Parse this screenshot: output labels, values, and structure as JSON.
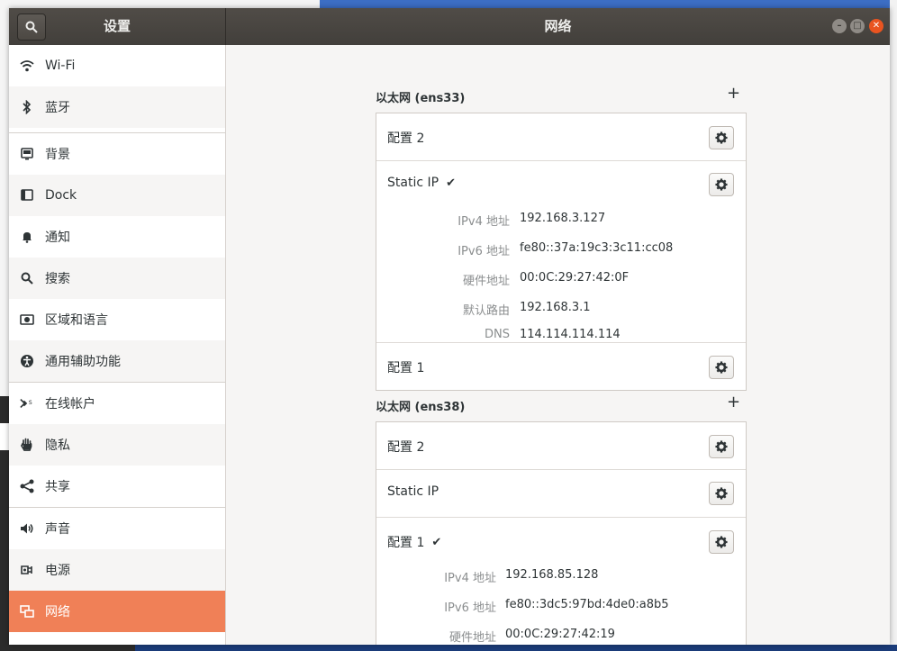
{
  "window": {
    "left_title": "设置",
    "main_title": "网络"
  },
  "sidebar": {
    "items": [
      {
        "label": "Wi-Fi",
        "icon": "wifi-icon"
      },
      {
        "label": "蓝牙",
        "icon": "bluetooth-icon"
      },
      {
        "label": "背景",
        "icon": "background-icon"
      },
      {
        "label": "Dock",
        "icon": "dock-icon"
      },
      {
        "label": "通知",
        "icon": "bell-icon"
      },
      {
        "label": "搜索",
        "icon": "search-icon"
      },
      {
        "label": "区域和语言",
        "icon": "region-icon"
      },
      {
        "label": "通用辅助功能",
        "icon": "accessibility-icon"
      },
      {
        "label": "在线帐户",
        "icon": "online-accounts-icon"
      },
      {
        "label": "隐私",
        "icon": "hand-icon"
      },
      {
        "label": "共享",
        "icon": "share-icon"
      },
      {
        "label": "声音",
        "icon": "speaker-icon"
      },
      {
        "label": "电源",
        "icon": "power-plug-icon"
      },
      {
        "label": "网络",
        "icon": "network-icon"
      }
    ]
  },
  "ens33": {
    "title": "以太网 (ens33)",
    "add": "+",
    "profile_2": "配置 2",
    "static_ip": "Static IP",
    "check": "✔",
    "ipv4_key": "IPv4 地址",
    "ipv4_val": "192.168.3.127",
    "ipv6_key": "IPv6 地址",
    "ipv6_val": "fe80::37a:19c3:3c11:cc08",
    "hw_key": "硬件地址",
    "hw_val": "00:0C:29:27:42:0F",
    "route_key": "默认路由",
    "route_val": "192.168.3.1",
    "dns_key": "DNS",
    "dns_val": "114.114.114.114",
    "profile_1": "配置 1"
  },
  "ens38": {
    "title": "以太网 (ens38)",
    "add": "+",
    "profile_2": "配置 2",
    "static_ip": "Static IP",
    "profile_1": "配置 1",
    "check": "✔",
    "ipv4_key": "IPv4 地址",
    "ipv4_val": "192.168.85.128",
    "ipv6_key": "IPv6 地址",
    "ipv6_val": "fe80::3dc5:97bd:4de0:a8b5",
    "hw_key": "硬件地址",
    "hw_val": "00:0C:29:27:42:19"
  },
  "colors": {
    "accent": "#f08057",
    "titlebar": "#45413d",
    "close": "#e95420"
  }
}
